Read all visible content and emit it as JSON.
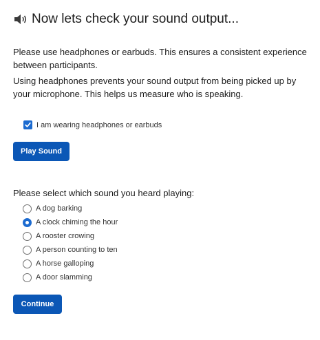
{
  "header": {
    "icon": "speaker-icon",
    "title": "Now lets check your sound output..."
  },
  "intro": {
    "paragraph1": "Please use headphones or earbuds. This ensures a consistent experience between participants.",
    "paragraph2": "Using headphones prevents your sound output from being picked up by your microphone. This helps us measure who is speaking."
  },
  "headphones_check": {
    "label": "I am wearing headphones or earbuds",
    "checked": true
  },
  "play_button": {
    "label": "Play Sound"
  },
  "sound_question": {
    "prompt": "Please select which sound you heard playing:",
    "options": [
      {
        "label": "A dog barking",
        "selected": false
      },
      {
        "label": "A clock chiming the hour",
        "selected": true
      },
      {
        "label": "A rooster crowing",
        "selected": false
      },
      {
        "label": "A person counting to ten",
        "selected": false
      },
      {
        "label": "A horse galloping",
        "selected": false
      },
      {
        "label": "A door slamming",
        "selected": false
      }
    ]
  },
  "continue_button": {
    "label": "Continue"
  },
  "colors": {
    "primary_button": "#0b57b6",
    "checked_control": "#1c6bd0"
  }
}
